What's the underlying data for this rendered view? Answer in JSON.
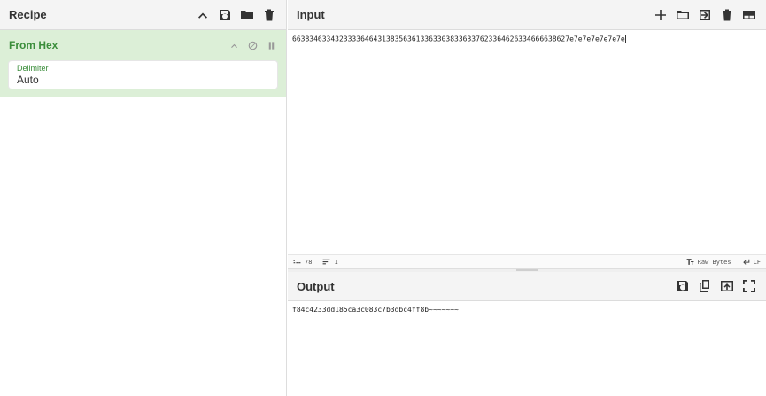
{
  "recipe": {
    "title": "Recipe",
    "icons": [
      "chevron-up-icon",
      "save-icon",
      "folder-icon",
      "trash-icon"
    ],
    "operation": {
      "title": "From Hex",
      "delimiter_label": "Delimiter",
      "delimiter_value": "Auto"
    }
  },
  "input": {
    "title": "Input",
    "value": "66383463343233336464313835636133633038336337623364626334666638627e7e7e7e7e7e7e",
    "status": {
      "length": "78",
      "lines": "1",
      "encoding": "Raw Bytes",
      "eol": "LF"
    }
  },
  "output": {
    "title": "Output",
    "value": "f84c4233dd185ca3c083c7b3dbc4ff8b~~~~~~~"
  },
  "colors": {
    "accent_green": "#3a8d3a",
    "op_bg": "#dcefd7",
    "header_bg": "#f4f4f4"
  }
}
